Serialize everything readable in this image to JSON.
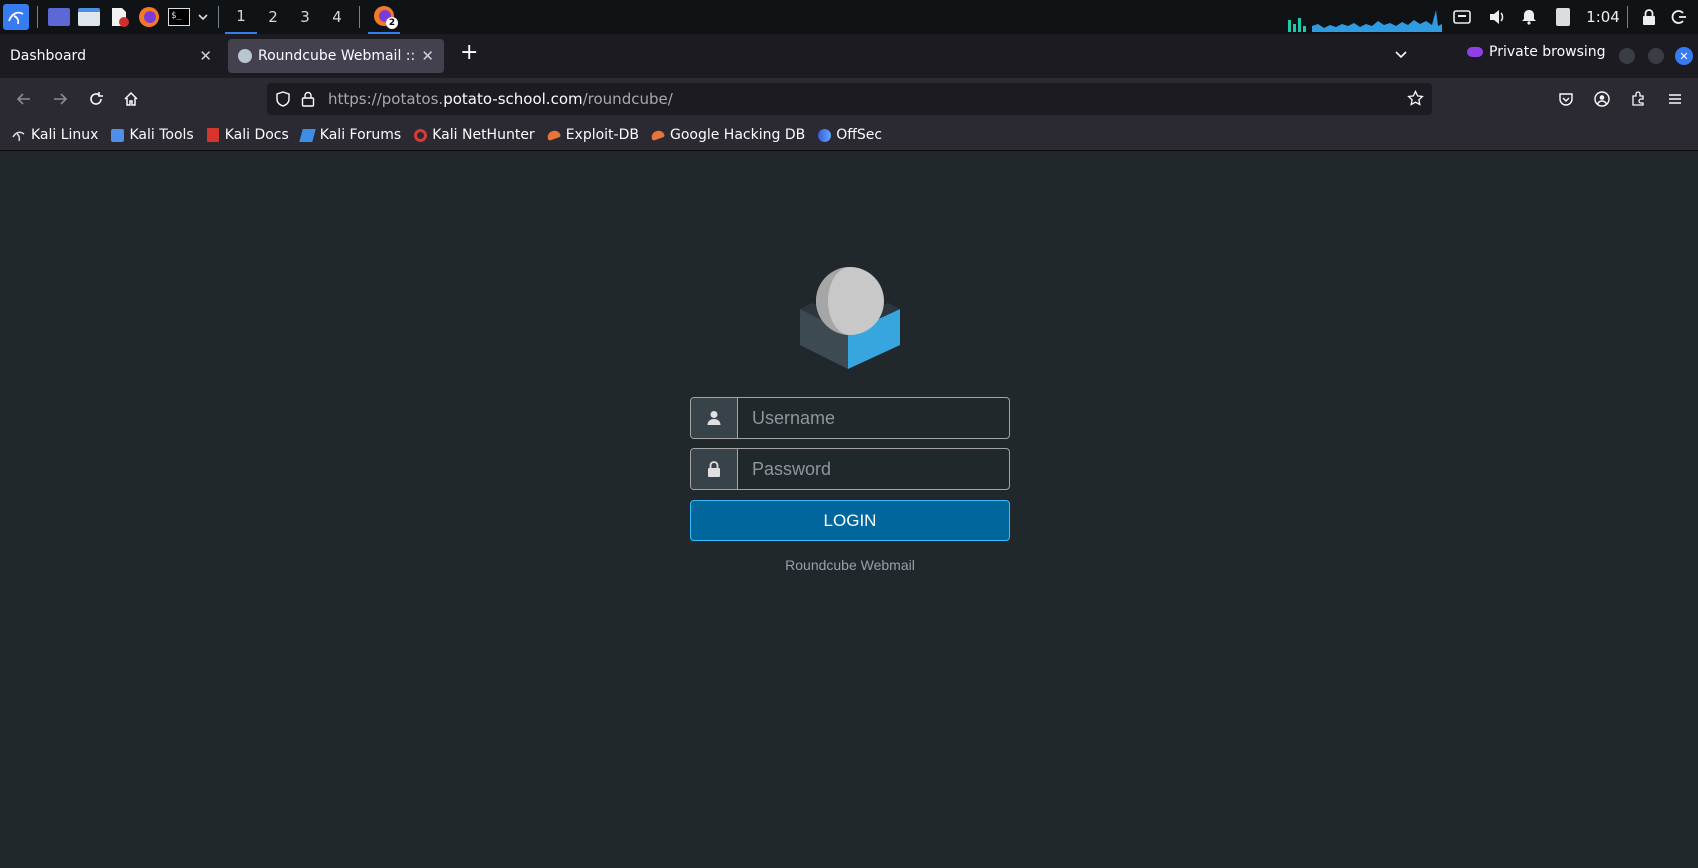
{
  "panel": {
    "workspaces": [
      "1",
      "2",
      "3",
      "4"
    ],
    "active_workspace": "1",
    "firefox_badge": "2",
    "clock": "1:04",
    "icons": [
      "kali-menu-icon",
      "desktop-icon",
      "files-icon",
      "text-editor-icon",
      "firefox-icon",
      "terminal-icon",
      "chevron-down-icon",
      "network-icon",
      "volume-icon",
      "bell-icon",
      "clipboard-icon",
      "lock-icon",
      "logout-icon"
    ]
  },
  "browser": {
    "tabs": [
      {
        "label": "Dashboard",
        "active": false
      },
      {
        "label": "Roundcube Webmail :: We",
        "active": true
      }
    ],
    "private_label": "Private browsing",
    "url": {
      "prefix": "https://potatos.",
      "host": "potato-school.com",
      "path": "/roundcube/"
    },
    "bookmarks": [
      {
        "label": "Kali Linux",
        "icon": "kali-dragon-icon"
      },
      {
        "label": "Kali Tools",
        "icon": "kali-tools-icon"
      },
      {
        "label": "Kali Docs",
        "icon": "kali-docs-icon"
      },
      {
        "label": "Kali Forums",
        "icon": "kali-forums-icon"
      },
      {
        "label": "Kali NetHunter",
        "icon": "nethunter-icon"
      },
      {
        "label": "Exploit-DB",
        "icon": "exploit-db-icon"
      },
      {
        "label": "Google Hacking DB",
        "icon": "ghdb-icon"
      },
      {
        "label": "OffSec",
        "icon": "offsec-icon"
      }
    ]
  },
  "login": {
    "username_placeholder": "Username",
    "password_placeholder": "Password",
    "button_label": "LOGIN",
    "footer": "Roundcube Webmail"
  },
  "colors": {
    "page_bg": "#21282c",
    "button_bg": "#00669c",
    "button_border": "#37beff",
    "accent": "#367bf0",
    "logo_blue": "#37a6df"
  }
}
